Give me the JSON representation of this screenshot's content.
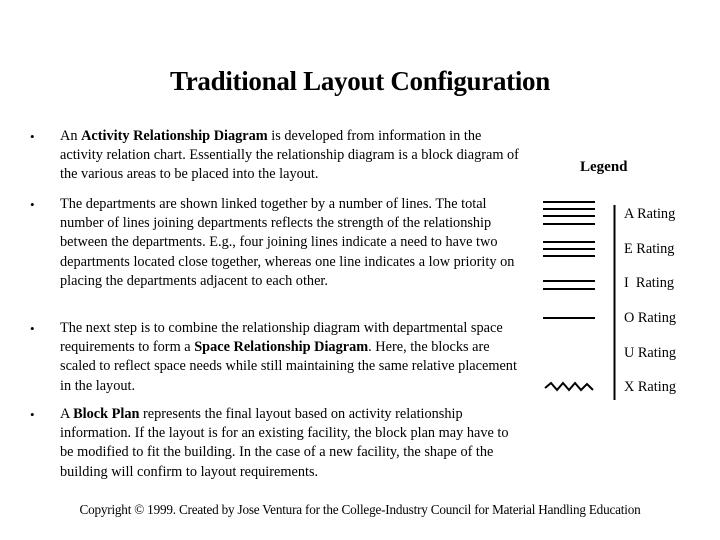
{
  "slide": {
    "title": "Traditional Layout Configuration",
    "bullets": [
      {
        "parts": [
          {
            "text": "An ",
            "bold": false
          },
          {
            "text": "Activity Relationship Diagram",
            "bold": true
          },
          {
            "text": " is developed from information in the activity relation chart. Essentially the relationship diagram is a block diagram of the various areas to be placed into the layout.",
            "bold": false
          }
        ]
      },
      {
        "parts": [
          {
            "text": "The departments are shown linked together by a number of lines. The total number of lines joining departments reflects the strength of the relationship between the departments. E.g., four joining lines indicate a need to have two departments located close together, whereas one line indicates a low priority on placing the departments adjacent to each other.",
            "bold": false
          }
        ]
      },
      {
        "parts": [
          {
            "text": "The next step is to combine the relationship diagram with departmental space requirements to form a ",
            "bold": false
          },
          {
            "text": "Space Relationship Diagram",
            "bold": true
          },
          {
            "text": ". Here, the blocks are scaled to reflect space needs while still maintaining the same relative placement in the layout.",
            "bold": false
          }
        ]
      },
      {
        "parts": [
          {
            "text": "A ",
            "bold": false
          },
          {
            "text": "Block Plan",
            "bold": true
          },
          {
            "text": " represents the final layout based on activity relationship information. If the layout is for an existing facility, the block plan may have to be modified to fit the building. In the case of a new facility, the shape of the building will confirm to layout requirements.",
            "bold": false
          }
        ]
      }
    ],
    "bullet_symbol": "•",
    "legend": {
      "title": "Legend",
      "items": [
        {
          "label": "A Rating",
          "symbol": "four-lines",
          "line_count": 4
        },
        {
          "label": "E Rating",
          "symbol": "three-lines",
          "line_count": 3
        },
        {
          "label": "I  Rating",
          "symbol": "two-lines",
          "line_count": 2
        },
        {
          "label": "O Rating",
          "symbol": "one-line",
          "line_count": 1
        },
        {
          "label": "U Rating",
          "symbol": "none",
          "line_count": 0
        },
        {
          "label": "X Rating",
          "symbol": "zigzag-line",
          "line_count": 0
        }
      ]
    },
    "copyright": "Copyright © 1999.  Created by Jose Ventura for the College-Industry Council for Material Handling Education"
  }
}
